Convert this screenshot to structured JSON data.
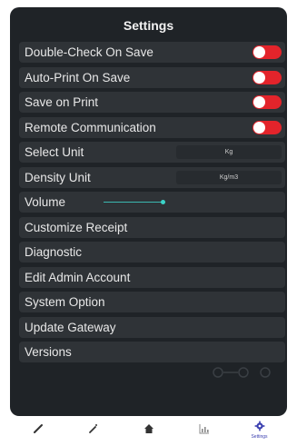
{
  "header": {
    "title": "Settings"
  },
  "settings": {
    "double_check_on_save": {
      "label": "Double-Check On Save",
      "enabled": false
    },
    "auto_print_on_save": {
      "label": "Auto-Print On Save",
      "enabled": false
    },
    "save_on_print": {
      "label": "Save on Print",
      "enabled": false
    },
    "remote_communication": {
      "label": "Remote Communication",
      "enabled": false
    },
    "select_unit": {
      "label": "Select Unit",
      "value": "Kg"
    },
    "density_unit": {
      "label": "Density Unit",
      "value": "Kg/m3"
    },
    "volume": {
      "label": "Volume",
      "level": 0.95
    },
    "menu": [
      "Customize Receipt",
      "Diagnostic",
      "Edit Admin Account",
      "System Option",
      "Update Gateway",
      "Versions"
    ]
  },
  "colors": {
    "toggle": "#e3242b",
    "slider": "#3bb8b0",
    "active_tab": "#3b3fb0"
  },
  "tabbar": {
    "tabs": [
      {
        "icon": "pencil-icon",
        "label": ""
      },
      {
        "icon": "magic-wand-icon",
        "label": ""
      },
      {
        "icon": "home-icon",
        "label": ""
      },
      {
        "icon": "chart-icon",
        "label": ""
      },
      {
        "icon": "gear-icon",
        "label": "Settings",
        "active": true
      }
    ]
  }
}
